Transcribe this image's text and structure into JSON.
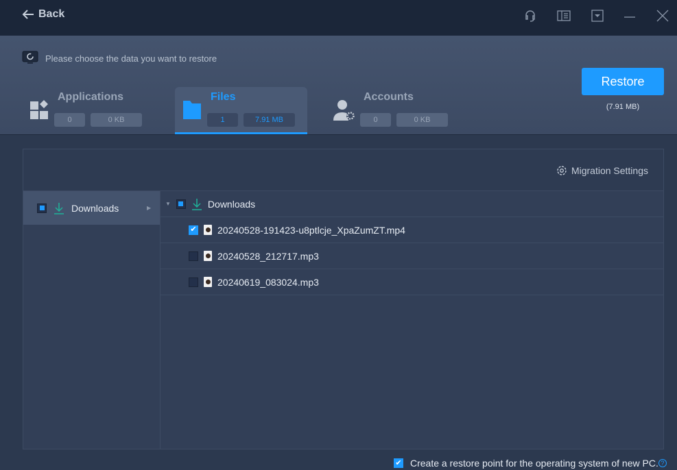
{
  "titlebar": {
    "back_label": "Back"
  },
  "header": {
    "hint": "Please choose the data you want to restore"
  },
  "tabs": [
    {
      "label": "Applications",
      "count": "0",
      "size": "0 KB"
    },
    {
      "label": "Files",
      "count": "1",
      "size": "7.91 MB"
    },
    {
      "label": "Accounts",
      "count": "0",
      "size": "0 KB"
    }
  ],
  "restore": {
    "label": "Restore",
    "size": "(7.91 MB)"
  },
  "panel": {
    "migration_settings": "Migration Settings",
    "left_items": [
      {
        "label": "Downloads"
      }
    ],
    "folder": "Downloads",
    "files": [
      {
        "name": "20240528-191423-u8ptlcje_XpaZumZT.mp4",
        "checked": true
      },
      {
        "name": "20240528_212717.mp3",
        "checked": false
      },
      {
        "name": "20240619_083024.mp3",
        "checked": false
      }
    ]
  },
  "footer": {
    "restore_point": "Create a restore point for the operating system of new PC."
  },
  "colors": {
    "accent": "#1e9bff",
    "download": "#1fb39a"
  }
}
